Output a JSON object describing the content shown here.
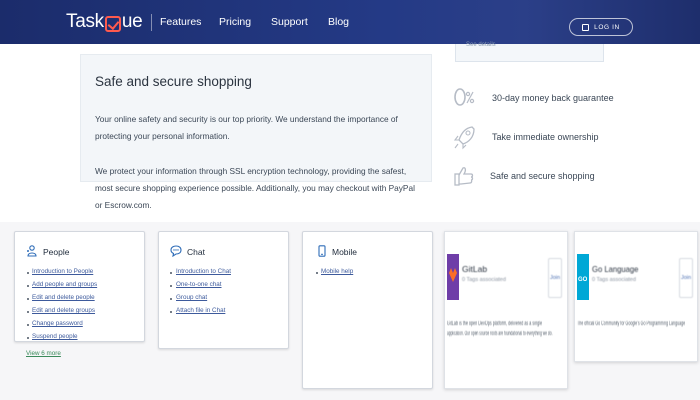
{
  "nav": {
    "logo": {
      "pre": "Task",
      "post": "ue"
    },
    "links": [
      "Features",
      "Pricing",
      "Support",
      "Blog"
    ],
    "login": "LOG IN"
  },
  "top_box": {
    "text": "See details"
  },
  "secure": {
    "title": "Safe and secure shopping",
    "p1_line1": "Your online safety and security is our top priority. We understand the importance of",
    "p1_line2": "protecting your personal information.",
    "p2_line1": "We protect your information through SSL encryption technology, providing the safest,",
    "p2_line2": "most secure shopping experience possible. Additionally, you may checkout with PayPal",
    "p2_line3": "or Escrow.com."
  },
  "features": [
    {
      "icon": "zero-percent-icon",
      "text": "30-day money back guarantee"
    },
    {
      "icon": "rocket-icon",
      "text": "Take immediate ownership"
    },
    {
      "icon": "thumbs-up-icon",
      "text": "Safe and secure shopping"
    }
  ],
  "cards": {
    "people": {
      "title": "People",
      "links": [
        "Introduction to People",
        "Add people and groups",
        "Edit and delete people",
        "Edit and delete groups",
        "Change password",
        "Suspend people"
      ],
      "view_more": "View 6 more"
    },
    "chat": {
      "title": "Chat",
      "links": [
        "Introduction to Chat",
        "One-to-one chat",
        "Group chat",
        "Attach file in Chat"
      ]
    },
    "mobile": {
      "title": "Mobile",
      "links": [
        "Mobile help"
      ]
    }
  },
  "tiles": [
    {
      "name": "GitLab",
      "sub": "0 Tags associated",
      "join": "Join",
      "desc": "GitLab is the open DevOps platform, delivered as a single",
      "desc2": "application. Our open source roots are foundational to everything we do.",
      "logo_color": "#6f3ea8",
      "logo_accent": "#fc6d26"
    },
    {
      "name": "Go Language",
      "sub": "0 Tags associated",
      "join": "Join",
      "desc": "The official Go Community for Google's Go Programming Language",
      "logo_color": "#00a8d6",
      "logo_accent": "#ffffff"
    }
  ],
  "colors": {
    "nav": "#1f317a",
    "accent": "#ff5a4e",
    "link": "#3d5a9c"
  }
}
